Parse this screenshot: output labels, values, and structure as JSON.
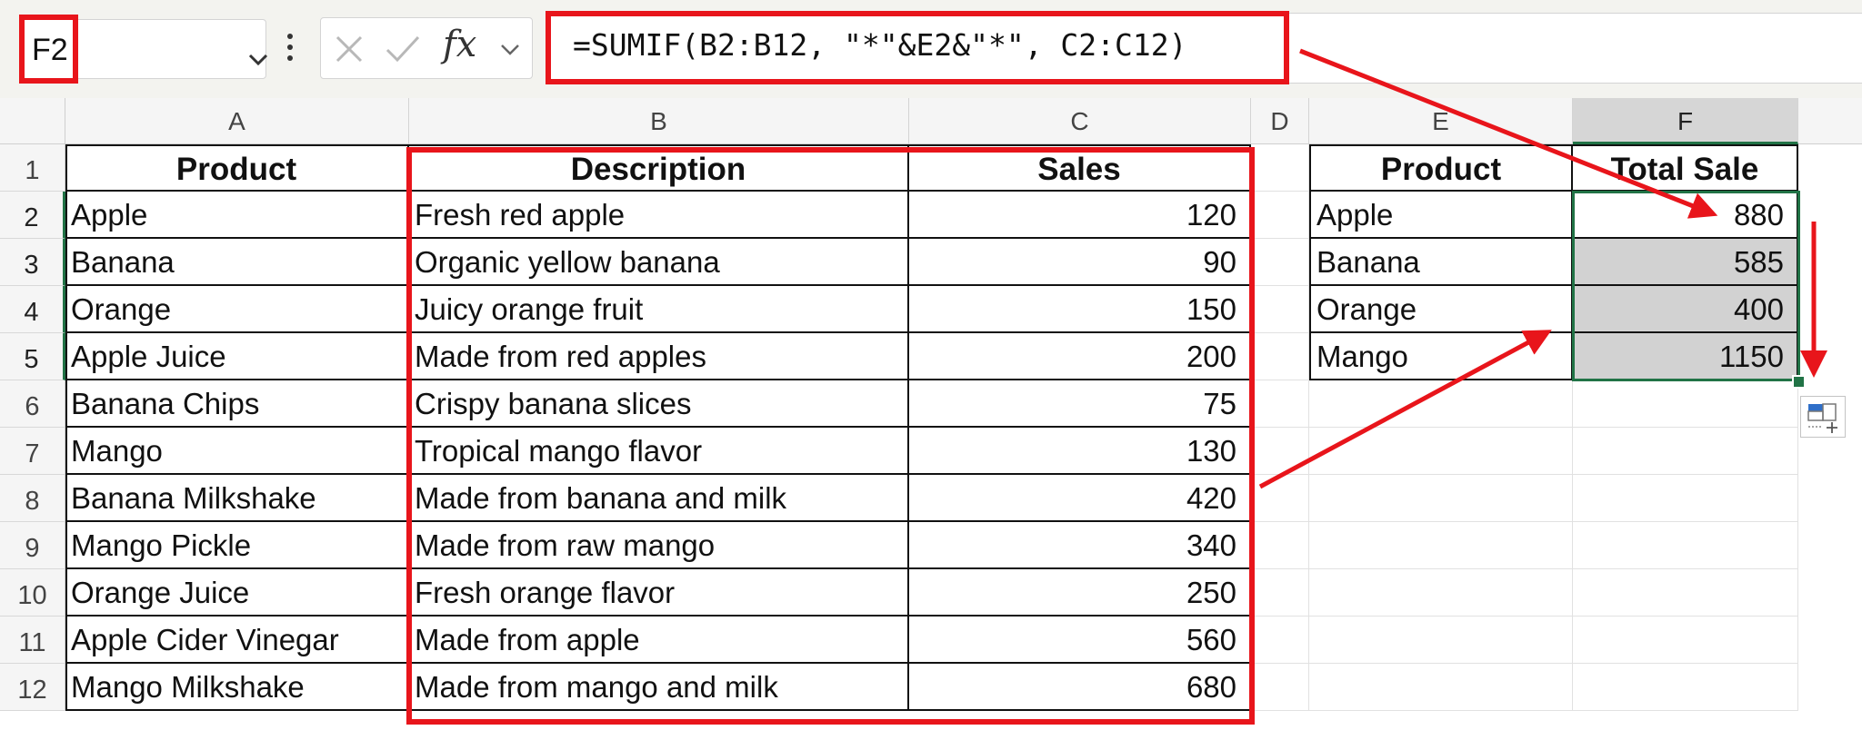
{
  "name_box": {
    "value": "F2"
  },
  "formula_bar": {
    "fx_label": "fx",
    "formula": "=SUMIF(B2:B12, \"*\"&E2&\"*\", C2:C12)"
  },
  "columns": [
    "A",
    "B",
    "C",
    "D",
    "E",
    "F"
  ],
  "rows": [
    "1",
    "2",
    "3",
    "4",
    "5",
    "6",
    "7",
    "8",
    "9",
    "10",
    "11",
    "12"
  ],
  "table1": {
    "headers": [
      "Product",
      "Description",
      "Sales"
    ],
    "rows": [
      [
        "Apple",
        "Fresh red apple",
        "120"
      ],
      [
        "Banana",
        "Organic yellow banana",
        "90"
      ],
      [
        "Orange",
        "Juicy orange fruit",
        "150"
      ],
      [
        "Apple Juice",
        "Made from red apples",
        "200"
      ],
      [
        "Banana Chips",
        "Crispy banana slices",
        "75"
      ],
      [
        "Mango",
        "Tropical mango flavor",
        "130"
      ],
      [
        "Banana Milkshake",
        "Made from banana and milk",
        "420"
      ],
      [
        "Mango Pickle",
        "Made from raw mango",
        "340"
      ],
      [
        "Orange Juice",
        "Fresh orange flavor",
        "250"
      ],
      [
        "Apple Cider Vinegar",
        "Made from apple",
        "560"
      ],
      [
        "Mango Milkshake",
        "Made from mango and milk",
        "680"
      ]
    ]
  },
  "table2": {
    "headers": [
      "Product",
      "Total Sale"
    ],
    "rows": [
      [
        "Apple",
        "880"
      ],
      [
        "Banana",
        "585"
      ],
      [
        "Orange",
        "400"
      ],
      [
        "Mango",
        "1150"
      ]
    ]
  },
  "colors": {
    "annotation_red": "#e8151b",
    "selection_green": "#217346",
    "fill_gray": "#d2d2d2"
  }
}
